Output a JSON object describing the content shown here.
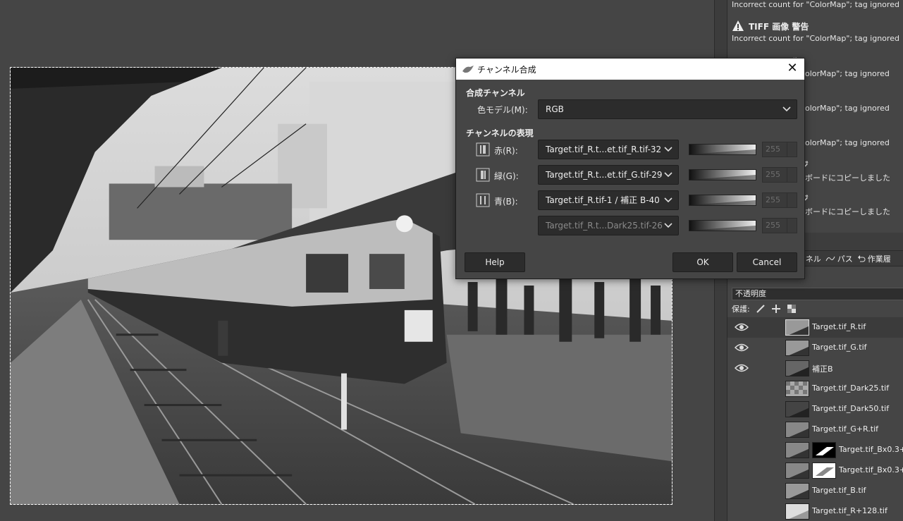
{
  "error_console": {
    "messages": [
      {
        "title": "",
        "body": "Incorrect count for \"ColorMap\"; tag ignored"
      },
      {
        "title": "TIFF 画像 警告",
        "body": "Incorrect count for \"ColorMap\"; tag ignored"
      },
      {
        "title": "告",
        "body": "olorMap\"; tag ignored"
      },
      {
        "title": "告",
        "body": "olorMap\"; tag ignored"
      },
      {
        "title": "告",
        "body": "olorMap\"; tag ignored"
      },
      {
        "title": "ージ",
        "body": "ボードにコピーしました"
      },
      {
        "title": "ージ",
        "body": "ボードにコピーしました"
      }
    ]
  },
  "dock_tabs": {
    "channels": "ンネル",
    "paths": "パス",
    "history": "作業履"
  },
  "layers_panel": {
    "mode": "不透明度",
    "lock_label": "保護:",
    "layers": [
      {
        "name": "Target.tif_R.tif",
        "visible": true,
        "has_mask": false,
        "selected": true
      },
      {
        "name": "Target.tif_G.tif",
        "visible": true,
        "has_mask": false,
        "selected": false
      },
      {
        "name": "補正B",
        "visible": true,
        "has_mask": false,
        "selected": false
      },
      {
        "name": "Target.tif_Dark25.tif",
        "visible": false,
        "has_mask": false,
        "selected": false
      },
      {
        "name": "Target.tif_Dark50.tif",
        "visible": false,
        "has_mask": false,
        "selected": false
      },
      {
        "name": "Target.tif_G+R.tif",
        "visible": false,
        "has_mask": false,
        "selected": false
      },
      {
        "name": "Target.tif_Bx0.3+(",
        "visible": false,
        "has_mask": true,
        "selected": false
      },
      {
        "name": "Target.tif_Bx0.3+(",
        "visible": false,
        "has_mask": true,
        "selected": false
      },
      {
        "name": "Target.tif_B.tif",
        "visible": false,
        "has_mask": false,
        "selected": false
      },
      {
        "name": "Target.tif_R+128.tif",
        "visible": false,
        "has_mask": false,
        "selected": false
      }
    ]
  },
  "dialog": {
    "title": "チャンネル合成",
    "section_compose": "合成チャンネル",
    "color_model_label": "色モデル(M):",
    "color_model_value": "RGB",
    "section_channels": "チャンネルの表現",
    "channels": [
      {
        "label": "赤(R):",
        "source": "Target.tif_R.t...et.tif_R.tif-32",
        "value": "255",
        "enabled": true
      },
      {
        "label": "緑(G):",
        "source": "Target.tif_R.t...et.tif_G.tif-29",
        "value": "255",
        "enabled": true
      },
      {
        "label": "青(B):",
        "source": "Target.tif_R.tif-1 / 補正 B-40",
        "value": "255",
        "enabled": true
      },
      {
        "label": "",
        "source": "Target.tif_R.t...Dark25.tif-26",
        "value": "255",
        "enabled": false
      }
    ],
    "help_label": "Help",
    "ok_label": "OK",
    "cancel_label": "Cancel"
  },
  "colors": {
    "background": "#454545",
    "dialog_bg": "#454545",
    "combo_bg": "#2c2c2c"
  }
}
